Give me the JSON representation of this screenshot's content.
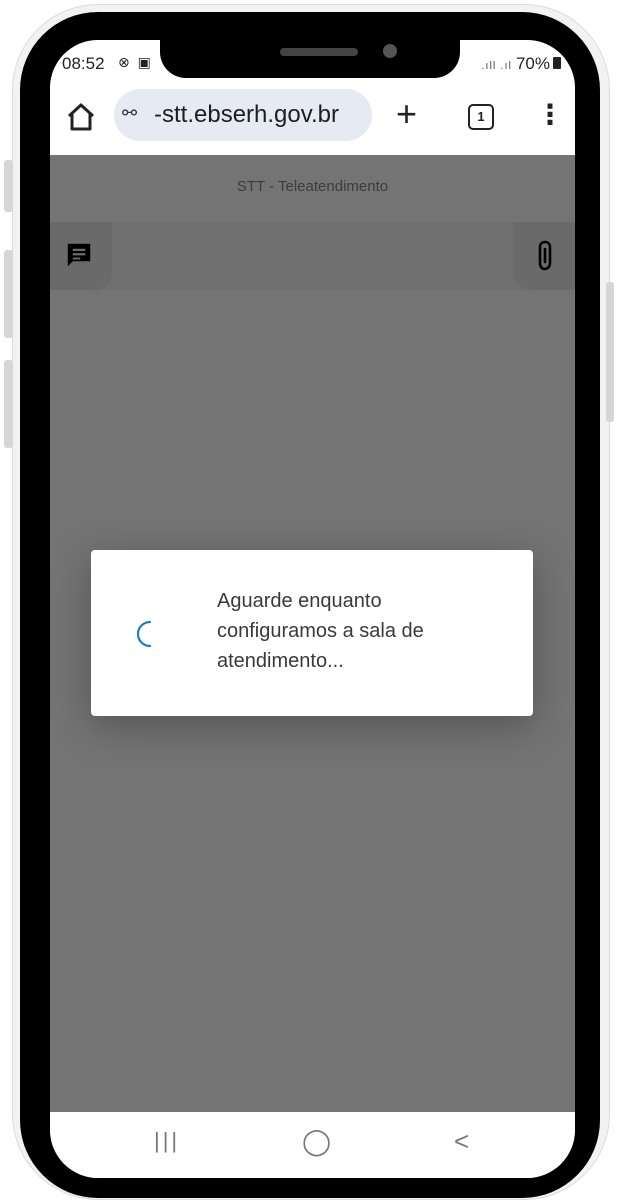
{
  "status_bar": {
    "time": "08:52",
    "left_icons": "⊗ ▣",
    "signal": ".ıll .ıl",
    "battery": "70%"
  },
  "browser": {
    "url": "-stt.ebserh.gov.br",
    "tab_count": "1",
    "new_tab_glyph": "+",
    "menu_glyph": "⋮",
    "site_settings_glyph": "⚯"
  },
  "page": {
    "title": "STT - Teleatendimento"
  },
  "dialog": {
    "message": "Aguarde enquanto configuramos a sala de atendimento...",
    "spinner_color": "#1a7fc4"
  },
  "nav_bar": {
    "recents_glyph": "|||",
    "home_glyph": "◯",
    "back_glyph": "<"
  },
  "colors": {
    "overlay": "#747474",
    "url_pill": "#e6ebf3"
  }
}
